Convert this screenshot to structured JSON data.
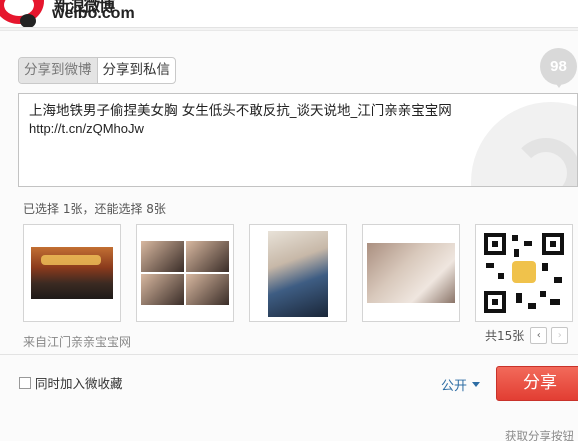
{
  "logo": {
    "brand_cn": "新浪微博",
    "url": "weibo.com"
  },
  "tabs": [
    {
      "label": "分享到微博",
      "active": true
    },
    {
      "label": "分享到私信",
      "active": false
    }
  ],
  "counter": "98",
  "share_text": {
    "title": "上海地铁男子偷捏美女胸 女生低头不敢反抗_谈天说地_江门亲亲宝宝网",
    "url": "http://t.cn/zQMhoJw"
  },
  "select_info": "已选择 1张，还能选择 8张",
  "thumbnails": [
    "night-street-crowd",
    "photo-collage",
    "subway-woman",
    "subway-closeup",
    "qr-code"
  ],
  "source": "来自江门亲亲宝宝网",
  "pager": {
    "count": "共15张",
    "prev": "‹",
    "next": "›"
  },
  "favorite_label": "同时加入微收藏",
  "visibility": "公开",
  "share_button": "分享",
  "bottom_link": "获取分享按钮",
  "colors": {
    "brand_red": "#e6162d",
    "button_red": "#e23e33",
    "link_blue": "#2e6da4"
  }
}
